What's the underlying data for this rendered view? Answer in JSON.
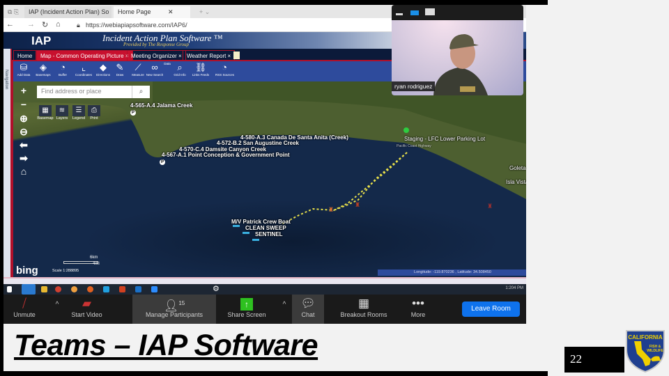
{
  "browser": {
    "tabs": [
      "IAP (Incident Action Plan) So",
      "Home Page"
    ],
    "url": "https://webiapiapsoftware.com/IAP6/"
  },
  "iap": {
    "logo": "IAP",
    "title": "Incident Action Plan Software ™",
    "subtitle": "Provided by The Response Group",
    "nav_tabs": [
      "Home",
      "Map - Common Operating Picture ×",
      "Meeting Organizer ×",
      "Weather Report ×"
    ],
    "tools": [
      "Add Data",
      "Basemaps",
      "Buffer",
      "Coordinates",
      "Directions",
      "Draw",
      "Measure",
      "New Search",
      "Data",
      "Grid Info",
      "Links Feeds",
      "RSS Sources"
    ],
    "sidebar_label": "Navigation"
  },
  "map": {
    "search_placeholder": "Find address or place",
    "tools": [
      "Basemap",
      "Layers",
      "Legend",
      "Print"
    ],
    "labels": [
      "4-565-A.4 Jalama Creek",
      "4-580-A.3 Canada De Santa Anita (Creek)",
      "4-572-B.2 San Augustine Creek",
      "4-570-C.4 Damsite Canyon Creek",
      "4-567-A.1 Point Conception & Government Point",
      "Staging - LFC Lower Parking Lot",
      "M/V Patrick Crew Boat",
      "CLEAN SWEEP",
      "SENTINEL",
      "Goleta",
      "Isla Vista",
      "Pacific Coast Highway"
    ],
    "scale_km": "6km",
    "scale_mi": "4mi",
    "scale_text": "Scale 1:288895",
    "bing": "bing",
    "coords": "Longitude: -119.870236 , Latitude: 34.508450"
  },
  "taskbar": {
    "time": "1:204 PM"
  },
  "zoom": {
    "unmute": "Unmute",
    "start_video": "Start Video",
    "participants": "Manage Participants",
    "participant_count": "15",
    "share": "Share Screen",
    "chat": "Chat",
    "breakout": "Breakout Rooms",
    "more": "More",
    "leave": "Leave Room",
    "participant_name": "ryan rodriguez"
  },
  "slide": {
    "title": "Teams – IAP Software",
    "page_number": "22",
    "logo_text": "CALIFORNIA FISH & WILDLIFE"
  },
  "colors": {
    "leave": "#0e72ed",
    "iap_toolbar": "#2e4b9c",
    "iap_red": "#b0102a",
    "route": "#e8e04a",
    "staging": "#2ecc40"
  }
}
